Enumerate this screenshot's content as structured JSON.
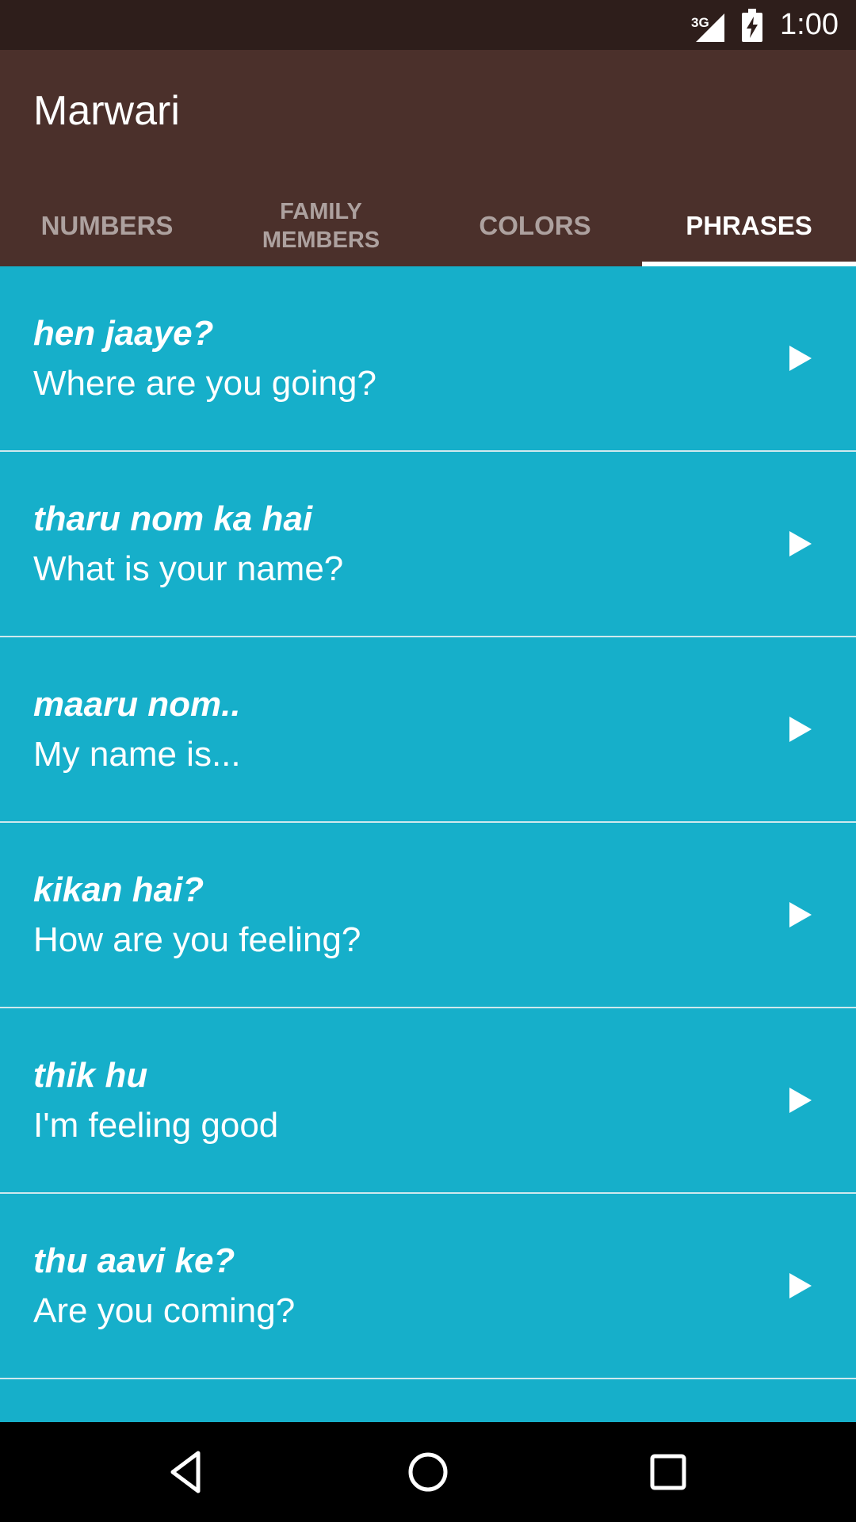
{
  "status_bar": {
    "network": "3G",
    "time": "1:00",
    "background": "#2E1E1B",
    "icons": [
      "signal-icon",
      "battery-charging-icon"
    ]
  },
  "app_bar": {
    "title": "Marwari",
    "background": "#4B302B"
  },
  "tabs": [
    {
      "label": "NUMBERS",
      "active": false
    },
    {
      "label": "FAMILY\nMEMBERS",
      "active": false
    },
    {
      "label": "COLORS",
      "active": false
    },
    {
      "label": "PHRASES",
      "active": true
    }
  ],
  "list": {
    "background": "#16AFCA",
    "items": [
      {
        "native": "hen jaaye?",
        "english": "Where are you going?",
        "icon": "play-icon"
      },
      {
        "native": "tharu nom ka hai",
        "english": "What is your name?",
        "icon": "play-icon"
      },
      {
        "native": "maaru nom..",
        "english": "My name is...",
        "icon": "play-icon"
      },
      {
        "native": "kikan hai?",
        "english": "How are you feeling?",
        "icon": "play-icon"
      },
      {
        "native": "thik hu",
        "english": "I'm feeling good",
        "icon": "play-icon"
      },
      {
        "native": "thu aavi ke?",
        "english": "Are you coming?",
        "icon": "play-icon"
      },
      {
        "native": "",
        "english": "",
        "icon": ""
      }
    ]
  },
  "nav_bar": {
    "buttons": [
      "back-icon",
      "home-icon",
      "recents-icon"
    ]
  }
}
